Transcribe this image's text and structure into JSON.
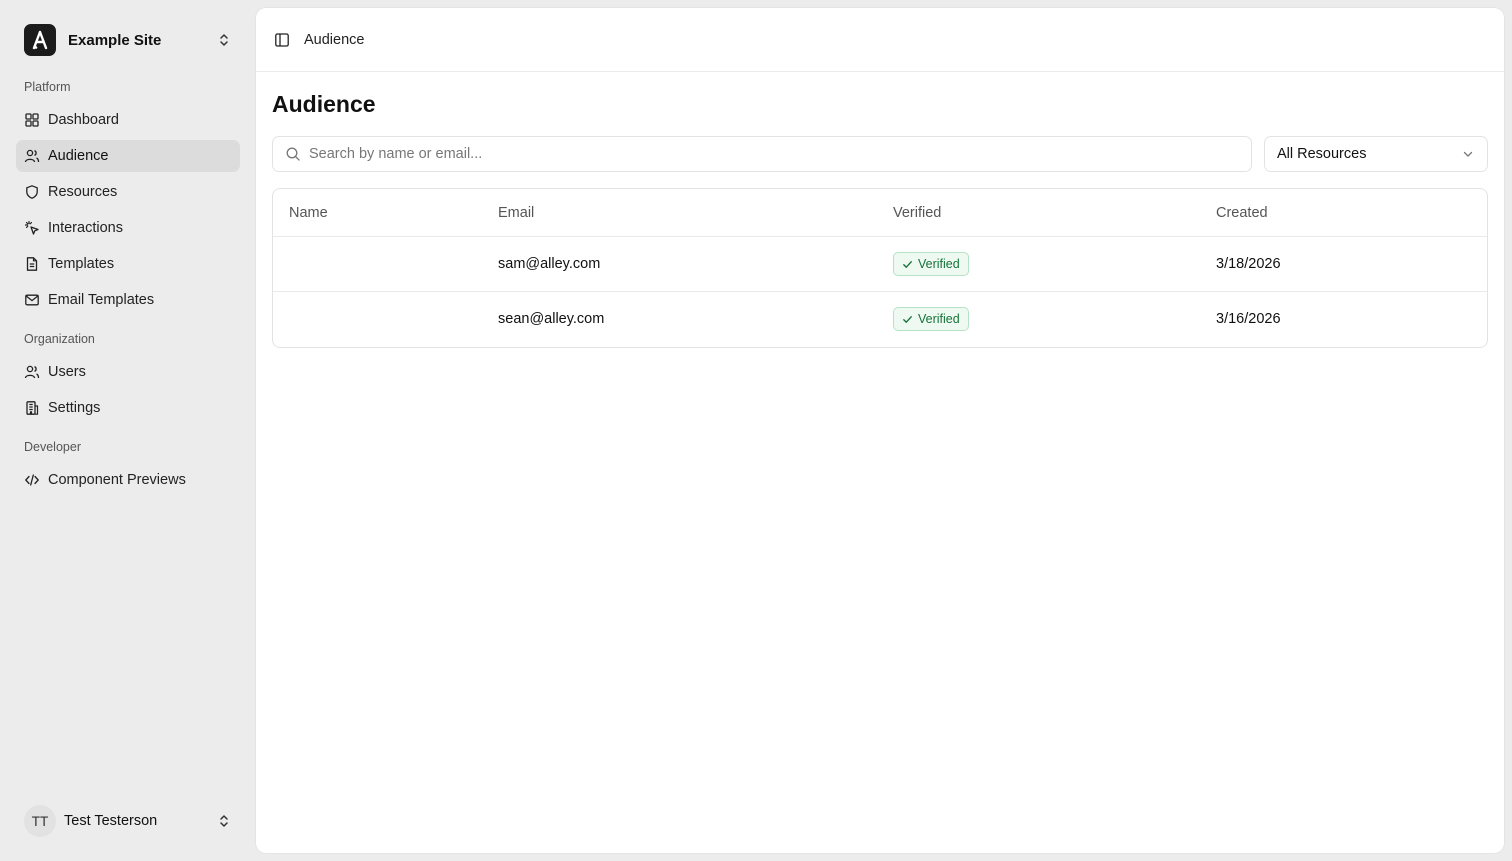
{
  "site": {
    "name": "Example Site",
    "logo_letter": "A"
  },
  "sidebar": {
    "sections": [
      {
        "label": "Platform"
      },
      {
        "label": "Organization"
      },
      {
        "label": "Developer"
      }
    ],
    "items": [
      {
        "label": "Dashboard",
        "icon": "grid-icon"
      },
      {
        "label": "Audience",
        "icon": "users-icon",
        "active": true
      },
      {
        "label": "Resources",
        "icon": "shield-icon"
      },
      {
        "label": "Interactions",
        "icon": "pointer-click-icon"
      },
      {
        "label": "Templates",
        "icon": "file-text-icon"
      },
      {
        "label": "Email Templates",
        "icon": "mail-icon"
      },
      {
        "label": "Users",
        "icon": "users-icon"
      },
      {
        "label": "Settings",
        "icon": "building-icon"
      },
      {
        "label": "Component Previews",
        "icon": "code-icon"
      }
    ]
  },
  "user": {
    "initials": "TT",
    "name": "Test Testerson"
  },
  "header": {
    "breadcrumb": "Audience"
  },
  "page": {
    "title": "Audience"
  },
  "search": {
    "placeholder": "Search by name or email...",
    "value": ""
  },
  "filter": {
    "selected": "All Resources"
  },
  "table": {
    "columns": [
      "Name",
      "Email",
      "Verified",
      "Created"
    ],
    "rows": [
      {
        "name": "",
        "email": "sam@alley.com",
        "verified": "Verified",
        "created": "3/18/2026"
      },
      {
        "name": "",
        "email": "sean@alley.com",
        "verified": "Verified",
        "created": "3/16/2026"
      }
    ]
  },
  "colors": {
    "accent_success": "#16733a",
    "active_nav_bg": "#dcdcdc"
  }
}
